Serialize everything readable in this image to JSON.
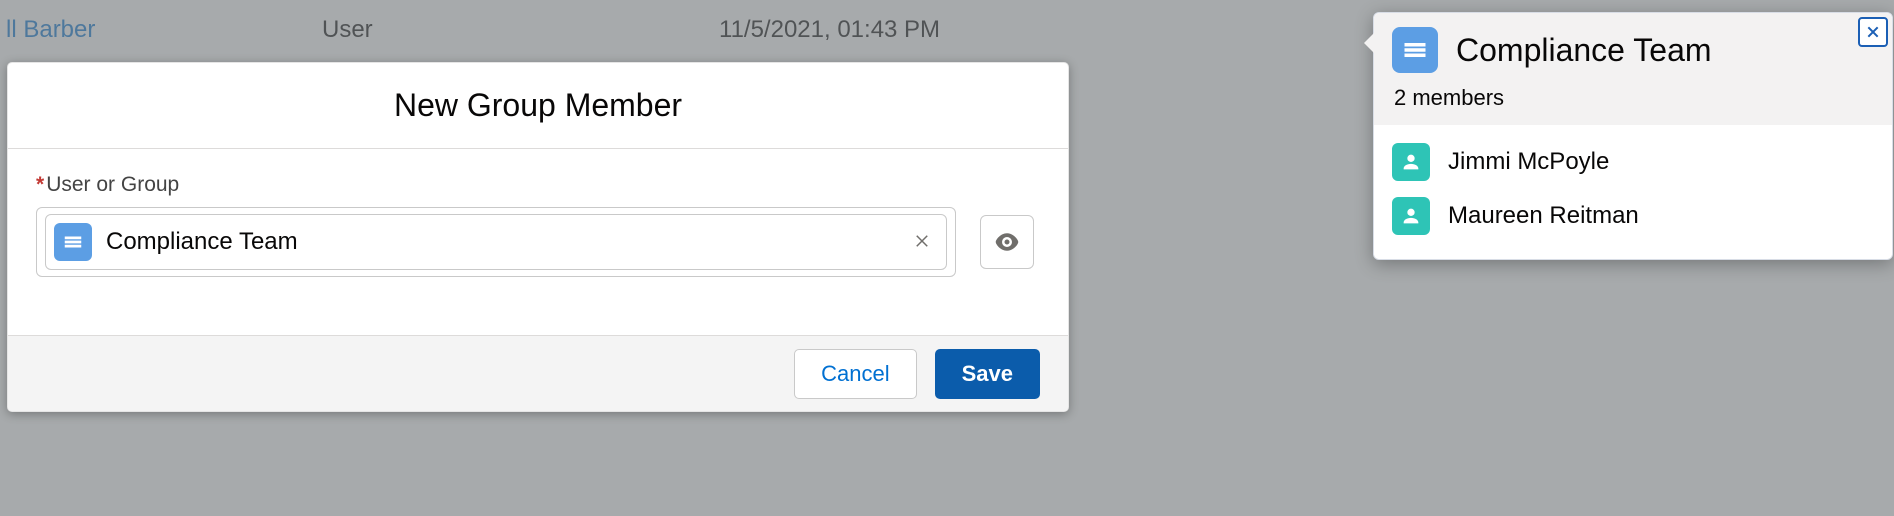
{
  "bgRow": {
    "link": "ll Barber",
    "type": "User",
    "date": "11/5/2021, 01:43 PM"
  },
  "modal": {
    "title": "New Group Member",
    "fieldLabel": "User or Group",
    "selected": "Compliance Team",
    "buttons": {
      "cancel": "Cancel",
      "save": "Save"
    }
  },
  "popover": {
    "title": "Compliance Team",
    "subtitle": "2 members",
    "members": [
      {
        "name": "Jimmi McPoyle"
      },
      {
        "name": "Maureen Reitman"
      }
    ]
  },
  "icons": {
    "group": "group-icon",
    "user": "user-icon"
  }
}
